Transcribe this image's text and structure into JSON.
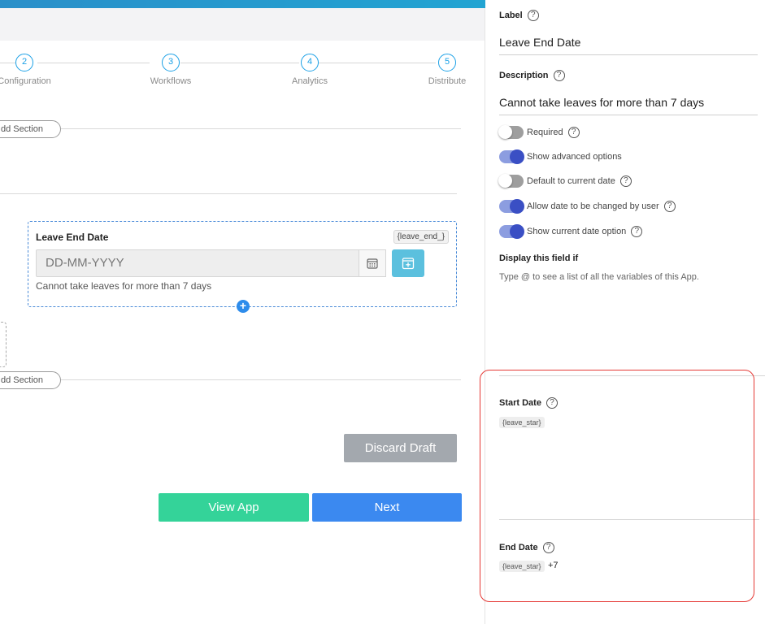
{
  "steps": [
    {
      "num": "2",
      "label": "Configuration"
    },
    {
      "num": "3",
      "label": "Workflows"
    },
    {
      "num": "4",
      "label": "Analytics"
    },
    {
      "num": "5",
      "label": "Distribute"
    }
  ],
  "add_section_label": "dd Section",
  "field": {
    "title": "Leave End Date",
    "variable": "{leave_end_}",
    "placeholder": "DD-MM-YYYY",
    "help": "Cannot take leaves for more than 7 days"
  },
  "buttons": {
    "discard": "Discard Draft",
    "view_app": "View App",
    "next": "Next"
  },
  "panel": {
    "label_title": "Label",
    "label_value": "Leave End Date",
    "description_title": "Description",
    "description_value": "Cannot take leaves for more than 7 days",
    "toggles": [
      {
        "label": "Required",
        "on": false,
        "help": true
      },
      {
        "label": "Show advanced options",
        "on": true,
        "help": false
      },
      {
        "label": "Default to current date",
        "on": false,
        "help": true
      },
      {
        "label": "Allow date to be changed by user",
        "on": true,
        "help": true
      },
      {
        "label": "Show current date option",
        "on": true,
        "help": true
      }
    ],
    "display_if_title": "Display this field if",
    "display_if_hint": "Type @ to see a list of all the variables of this App.",
    "start_date_title": "Start Date",
    "start_date_var": "{leave_star}",
    "end_date_title": "End Date",
    "end_date_var": "{leave_star}",
    "end_date_suffix": "+7"
  },
  "help_glyph": "?",
  "colors": {
    "accent": "#1aa0e6",
    "view_app": "#34d399",
    "next": "#3b89f0",
    "discard": "#a3a8ae",
    "highlight": "#e53935"
  }
}
